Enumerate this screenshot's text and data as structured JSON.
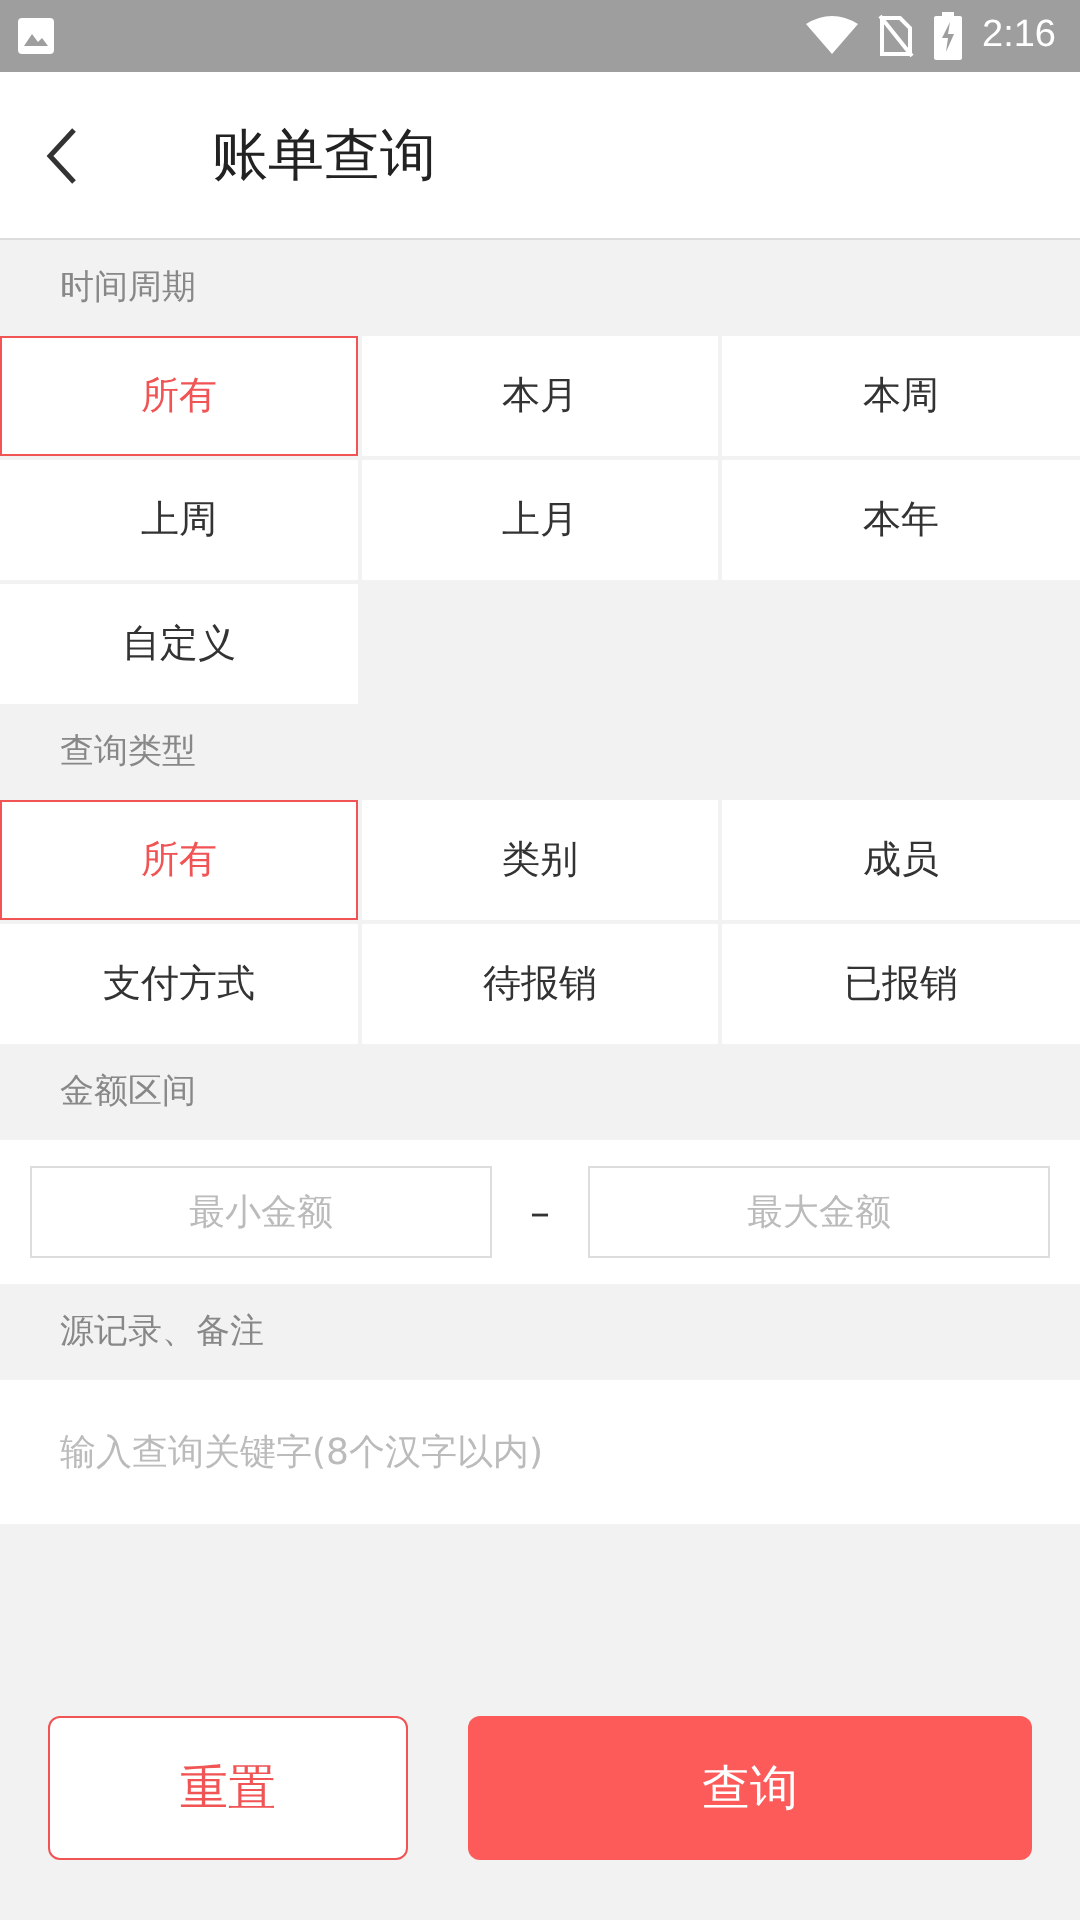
{
  "status_bar": {
    "time": "2:16"
  },
  "header": {
    "title": "账单查询"
  },
  "period": {
    "label": "时间周期",
    "options": [
      {
        "label": "所有",
        "selected": true
      },
      {
        "label": "本月",
        "selected": false
      },
      {
        "label": "本周",
        "selected": false
      },
      {
        "label": "上周",
        "selected": false
      },
      {
        "label": "上月",
        "selected": false
      },
      {
        "label": "本年",
        "selected": false
      },
      {
        "label": "自定义",
        "selected": false
      }
    ]
  },
  "query_type": {
    "label": "查询类型",
    "options": [
      {
        "label": "所有",
        "selected": true
      },
      {
        "label": "类别",
        "selected": false
      },
      {
        "label": "成员",
        "selected": false
      },
      {
        "label": "支付方式",
        "selected": false
      },
      {
        "label": "待报销",
        "selected": false
      },
      {
        "label": "已报销",
        "selected": false
      }
    ]
  },
  "amount": {
    "label": "金额区间",
    "min_placeholder": "最小金额",
    "separator": "–",
    "max_placeholder": "最大金额"
  },
  "notes": {
    "label": "源记录、备注",
    "placeholder": "输入查询关键字(8个汉字以内)"
  },
  "buttons": {
    "reset": "重置",
    "query": "查询"
  }
}
